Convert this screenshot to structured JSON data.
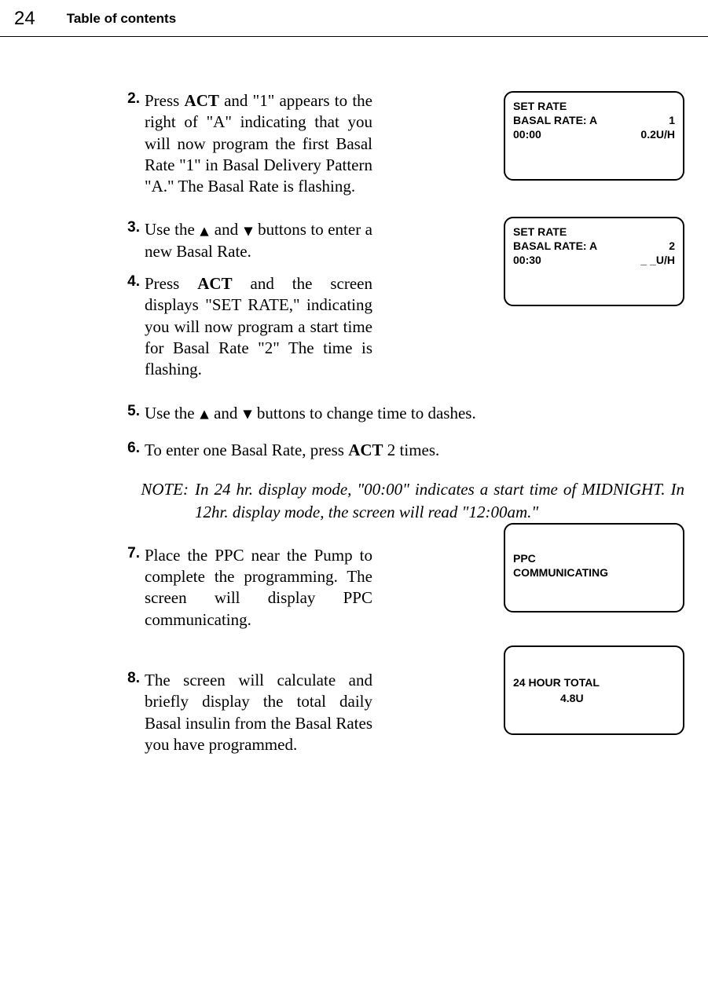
{
  "header": {
    "page_number": "24",
    "title": "Table of contents"
  },
  "steps": {
    "s2": {
      "num": "2.",
      "text_a": "Press ",
      "act": "ACT",
      "text_b": " and \"1\" appears to the right of \"A\" indicating that you will now program the first Basal Rate \"1\" in Basal Delivery Pattern \"A.\" The Basal Rate is flashing."
    },
    "s3": {
      "num": "3.",
      "text_a": "Use the ",
      "text_b": " and ",
      "text_c": " buttons to enter a new Basal Rate."
    },
    "s4": {
      "num": "4.",
      "text_a": "Press ",
      "act": "ACT",
      "text_b": " and the screen displays \"SET RATE,\" indicating you will now program a start time for Basal Rate \"2\" The time is flashing."
    },
    "s5": {
      "num": "5.",
      "text_a": "Use the ",
      "text_b": " and ",
      "text_c": " buttons to change time to dashes."
    },
    "s6": {
      "num": "6.",
      "text_a": "To enter one Basal Rate, press ",
      "act": "ACT",
      "text_b": " 2 times."
    },
    "s7": {
      "num": "7.",
      "text_a": "Place the PPC near the Pump to complete the programming. The screen will display PPC communicating."
    },
    "s8": {
      "num": "8.",
      "text_a": "The screen will calculate and briefly display the total daily Basal insulin from the Basal Rates you have programmed."
    }
  },
  "note": {
    "label": "NOTE:",
    "text": "In 24 hr. display mode, \"00:00\" indicates a start time of MIDNIGHT. In 12hr. display mode, the screen will read \"12:00am.\""
  },
  "screens": {
    "box1": {
      "line1": "SET RATE",
      "line2_left": "BASAL RATE: A",
      "line2_right": "1",
      "line3_left": "00:00",
      "line3_right": "0.2U/H"
    },
    "box2": {
      "line1": "SET RATE",
      "line2_left": "BASAL RATE: A",
      "line2_right": "2",
      "line3_left": "00:30",
      "line3_right": "_ _U/H"
    },
    "box3": {
      "line1": "PPC",
      "line2": "COMMUNICATING"
    },
    "box4": {
      "line1": "24 HOUR TOTAL",
      "line2": "4.8U"
    }
  }
}
